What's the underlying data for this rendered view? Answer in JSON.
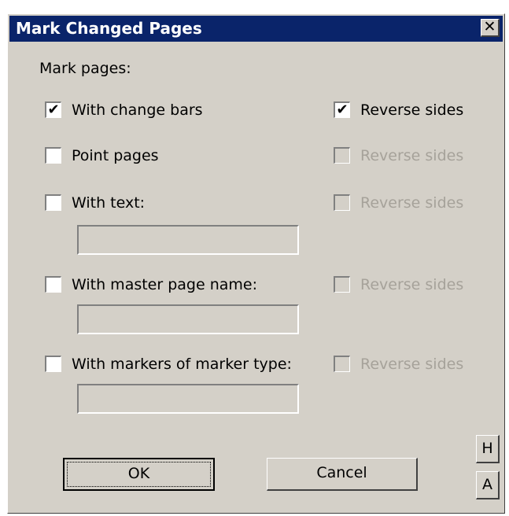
{
  "dialog": {
    "title": "Mark Changed Pages",
    "close_glyph": "✕"
  },
  "section_label": "Mark pages:",
  "options": [
    {
      "label": "With change bars",
      "checked": true,
      "reverse_label": "Reverse sides",
      "reverse_checked": true,
      "reverse_enabled": true
    },
    {
      "label": "Point pages",
      "checked": false,
      "reverse_label": "Reverse sides",
      "reverse_checked": false,
      "reverse_enabled": false
    },
    {
      "label": "With text:",
      "checked": false,
      "reverse_label": "Reverse sides",
      "reverse_checked": false,
      "reverse_enabled": false,
      "field_value": ""
    },
    {
      "label": "With master page name:",
      "checked": false,
      "reverse_label": "Reverse sides",
      "reverse_checked": false,
      "reverse_enabled": false,
      "field_value": ""
    },
    {
      "label": "With markers of marker type:",
      "checked": false,
      "reverse_label": "Reverse sides",
      "reverse_checked": false,
      "reverse_enabled": false,
      "field_value": ""
    }
  ],
  "check_glyph": "✔",
  "buttons": {
    "ok": "OK",
    "cancel": "Cancel",
    "h": "H",
    "a": "A"
  }
}
